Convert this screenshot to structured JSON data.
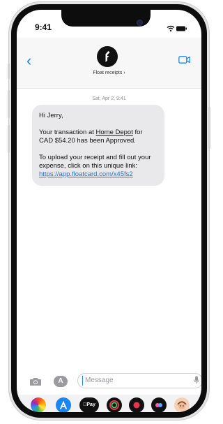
{
  "status_bar": {
    "time": "9:41"
  },
  "header": {
    "contact_name": "Float receipts ›"
  },
  "conversation": {
    "date_label": "Sat, Apr 2, 9:41",
    "message": {
      "greeting": "Hi Jerry,",
      "line2_pre": "Your transaction at ",
      "merchant": "Home Depot",
      "line2_post": " for CAD $54.20 has been Approved.",
      "line3": "To upload your receipt and fill out your expense, click on this unique link:",
      "link": "https://app.floatcard.com/x45fs2"
    }
  },
  "composer": {
    "placeholder": "Message",
    "apps_label": "A"
  },
  "app_tray": {
    "apple_pay_label": "Pay"
  },
  "colors": {
    "accent": "#1a86f2",
    "bubble": "#e9e9eb",
    "link": "#1f6fd6"
  }
}
